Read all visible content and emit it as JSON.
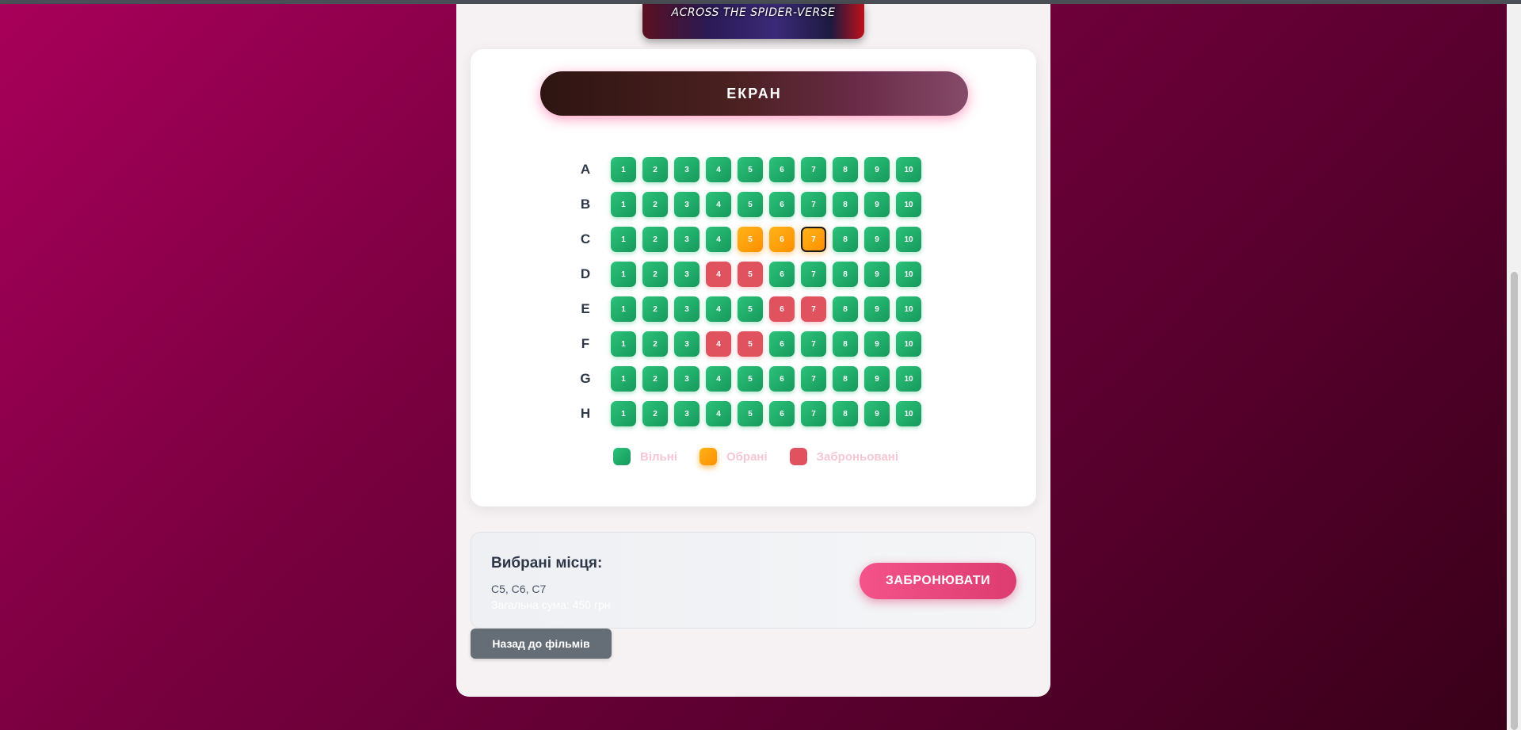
{
  "poster": {
    "text": "ACROSS THE SPIDER-VERSE"
  },
  "screen": {
    "label": "ЕКРАН"
  },
  "seat_map": {
    "rows": [
      {
        "label": "A",
        "seats": [
          {
            "number": "1",
            "status": "free"
          },
          {
            "number": "2",
            "status": "free"
          },
          {
            "number": "3",
            "status": "free"
          },
          {
            "number": "4",
            "status": "free"
          },
          {
            "number": "5",
            "status": "free"
          },
          {
            "number": "6",
            "status": "free"
          },
          {
            "number": "7",
            "status": "free"
          },
          {
            "number": "8",
            "status": "free"
          },
          {
            "number": "9",
            "status": "free"
          },
          {
            "number": "10",
            "status": "free"
          }
        ]
      },
      {
        "label": "B",
        "seats": [
          {
            "number": "1",
            "status": "free"
          },
          {
            "number": "2",
            "status": "free"
          },
          {
            "number": "3",
            "status": "free"
          },
          {
            "number": "4",
            "status": "free"
          },
          {
            "number": "5",
            "status": "free"
          },
          {
            "number": "6",
            "status": "free"
          },
          {
            "number": "7",
            "status": "free"
          },
          {
            "number": "8",
            "status": "free"
          },
          {
            "number": "9",
            "status": "free"
          },
          {
            "number": "10",
            "status": "free"
          }
        ]
      },
      {
        "label": "C",
        "seats": [
          {
            "number": "1",
            "status": "free"
          },
          {
            "number": "2",
            "status": "free"
          },
          {
            "number": "3",
            "status": "free"
          },
          {
            "number": "4",
            "status": "free"
          },
          {
            "number": "5",
            "status": "selected"
          },
          {
            "number": "6",
            "status": "selected"
          },
          {
            "number": "7",
            "status": "selected",
            "focused": true
          },
          {
            "number": "8",
            "status": "free"
          },
          {
            "number": "9",
            "status": "free"
          },
          {
            "number": "10",
            "status": "free"
          }
        ]
      },
      {
        "label": "D",
        "seats": [
          {
            "number": "1",
            "status": "free"
          },
          {
            "number": "2",
            "status": "free"
          },
          {
            "number": "3",
            "status": "free"
          },
          {
            "number": "4",
            "status": "booked"
          },
          {
            "number": "5",
            "status": "booked"
          },
          {
            "number": "6",
            "status": "free"
          },
          {
            "number": "7",
            "status": "free"
          },
          {
            "number": "8",
            "status": "free"
          },
          {
            "number": "9",
            "status": "free"
          },
          {
            "number": "10",
            "status": "free"
          }
        ]
      },
      {
        "label": "E",
        "seats": [
          {
            "number": "1",
            "status": "free"
          },
          {
            "number": "2",
            "status": "free"
          },
          {
            "number": "3",
            "status": "free"
          },
          {
            "number": "4",
            "status": "free"
          },
          {
            "number": "5",
            "status": "free"
          },
          {
            "number": "6",
            "status": "booked"
          },
          {
            "number": "7",
            "status": "booked"
          },
          {
            "number": "8",
            "status": "free"
          },
          {
            "number": "9",
            "status": "free"
          },
          {
            "number": "10",
            "status": "free"
          }
        ]
      },
      {
        "label": "F",
        "seats": [
          {
            "number": "1",
            "status": "free"
          },
          {
            "number": "2",
            "status": "free"
          },
          {
            "number": "3",
            "status": "free"
          },
          {
            "number": "4",
            "status": "booked"
          },
          {
            "number": "5",
            "status": "booked"
          },
          {
            "number": "6",
            "status": "free"
          },
          {
            "number": "7",
            "status": "free"
          },
          {
            "number": "8",
            "status": "free"
          },
          {
            "number": "9",
            "status": "free"
          },
          {
            "number": "10",
            "status": "free"
          }
        ]
      },
      {
        "label": "G",
        "seats": [
          {
            "number": "1",
            "status": "free"
          },
          {
            "number": "2",
            "status": "free"
          },
          {
            "number": "3",
            "status": "free"
          },
          {
            "number": "4",
            "status": "free"
          },
          {
            "number": "5",
            "status": "free"
          },
          {
            "number": "6",
            "status": "free"
          },
          {
            "number": "7",
            "status": "free"
          },
          {
            "number": "8",
            "status": "free"
          },
          {
            "number": "9",
            "status": "free"
          },
          {
            "number": "10",
            "status": "free"
          }
        ]
      },
      {
        "label": "H",
        "seats": [
          {
            "number": "1",
            "status": "free"
          },
          {
            "number": "2",
            "status": "free"
          },
          {
            "number": "3",
            "status": "free"
          },
          {
            "number": "4",
            "status": "free"
          },
          {
            "number": "5",
            "status": "free"
          },
          {
            "number": "6",
            "status": "free"
          },
          {
            "number": "7",
            "status": "free"
          },
          {
            "number": "8",
            "status": "free"
          },
          {
            "number": "9",
            "status": "free"
          },
          {
            "number": "10",
            "status": "free"
          }
        ]
      }
    ]
  },
  "legend": {
    "free": "Вільні",
    "selected": "Обрані",
    "booked": "Заброньовані"
  },
  "summary": {
    "title": "Вибрані місця:",
    "seats": "C5, C6, C7",
    "total": "Загальна сума: 450 грн"
  },
  "buttons": {
    "book": "ЗАБРОНЮВАТИ",
    "back": "Назад до фільмів"
  },
  "colors": {
    "free": "#1fae6a",
    "selected": "#ff9f0a",
    "booked": "#e0525e",
    "accent": "#ec4b80"
  }
}
